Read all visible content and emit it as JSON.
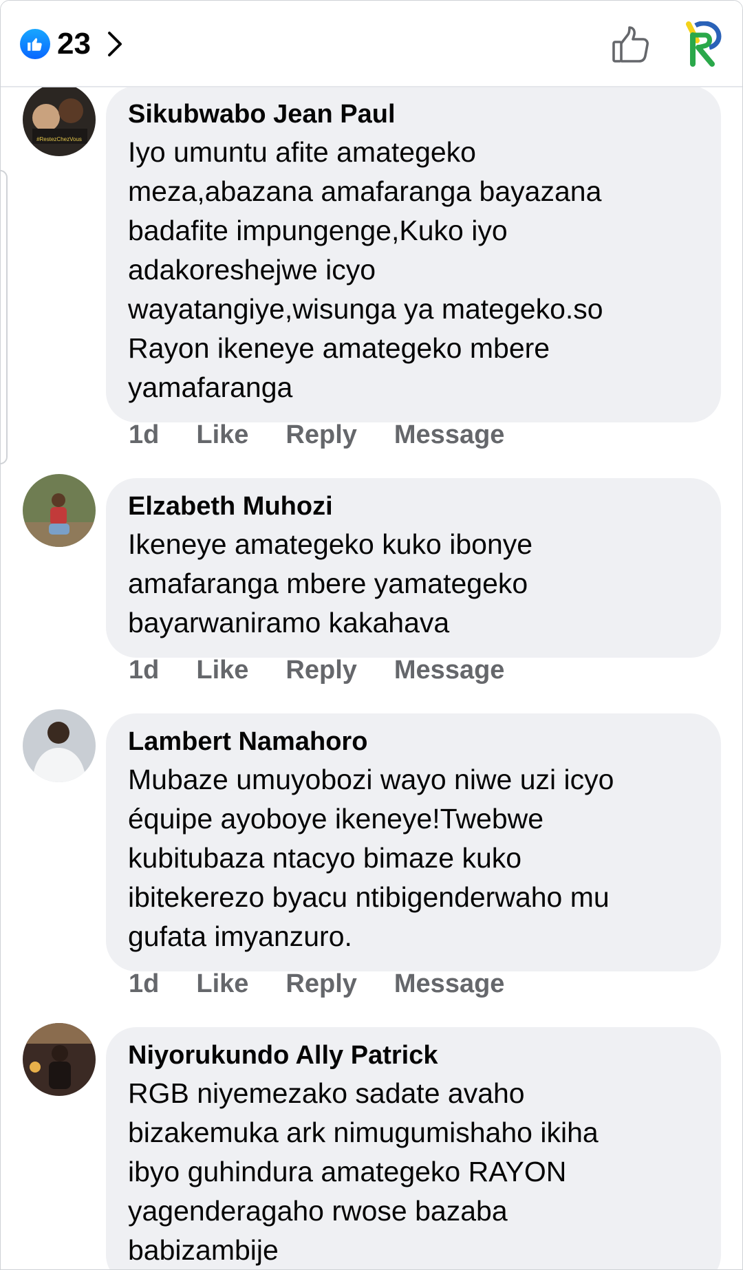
{
  "header": {
    "reaction_count": "23",
    "icons": {
      "like_badge": "like-thumb-icon",
      "chevron": "chevron-right-icon",
      "like_outline": "thumbs-up-outline-icon",
      "page_avatar": "page-logo-avatar"
    },
    "colors": {
      "like_blue": "#0866ff",
      "bubble_bg": "#eff0f3",
      "meta_gray": "#65676b"
    }
  },
  "comments": [
    {
      "author": "Sikubwabo Jean Paul",
      "text": "Iyo umuntu afite amategeko\nmeza,abazana amafaranga bayazana\nbadafite impungenge,Kuko iyo\nadakoreshejwe icyo\nwayatangiye,wisunga ya mategeko.so\nRayon ikeneye amategeko mbere\nyamafaranga",
      "time": "1d",
      "like_label": "Like",
      "reply_label": "Reply",
      "message_label": "Message"
    },
    {
      "author": "Elzabeth Muhozi",
      "text": "Ikeneye amategeko kuko ibonye\namafaranga mbere yamategeko\nbayarwaniramo kakahava",
      "time": "1d",
      "like_label": "Like",
      "reply_label": "Reply",
      "message_label": "Message"
    },
    {
      "author": "Lambert Namahoro",
      "text": "Mubaze umuyobozi wayo niwe uzi icyo\néquipe ayoboye ikeneye!Twebwe\nkubitubaza ntacyo bimaze kuko\nibitekerezo byacu ntibigenderwaho mu\ngufata imyanzuro.",
      "time": "1d",
      "like_label": "Like",
      "reply_label": "Reply",
      "message_label": "Message"
    },
    {
      "author": "Niyorukundo Ally Patrick",
      "text": "RGB niyemezako sadate avaho\nbizakemuka ark nimugumishaho ikiha\nibyo guhindura amategeko RAYON\nyagenderagaho rwose bazaba\nbabizambije",
      "time": "",
      "like_label": "",
      "reply_label": "",
      "message_label": ""
    }
  ]
}
